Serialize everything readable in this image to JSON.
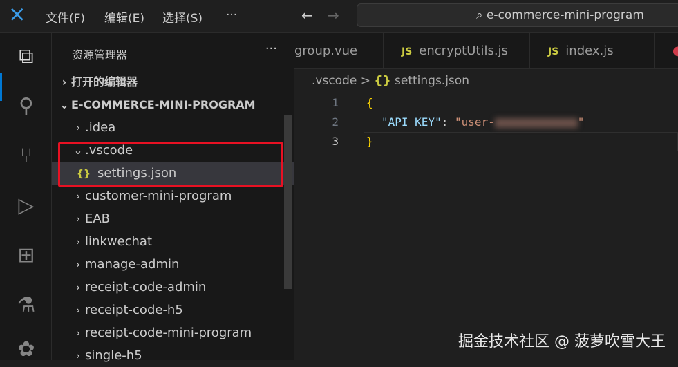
{
  "titlebar": {
    "menus": [
      "文件(F)",
      "编辑(E)",
      "选择(S)",
      "···"
    ],
    "search": "e-commerce-mini-program"
  },
  "sidebar": {
    "title": "资源管理器",
    "more": "···",
    "open_editors": "打开的编辑器",
    "root": "E-COMMERCE-MINI-PROGRAM",
    "items": [
      {
        "label": ".idea",
        "expanded": false,
        "indent": 1
      },
      {
        "label": ".vscode",
        "expanded": true,
        "indent": 1
      },
      {
        "label": "settings.json",
        "file": true,
        "indent": 2
      },
      {
        "label": "customer-mini-program",
        "expanded": false,
        "indent": 1
      },
      {
        "label": "EAB",
        "expanded": false,
        "indent": 1
      },
      {
        "label": "linkwechat",
        "expanded": false,
        "indent": 1
      },
      {
        "label": "manage-admin",
        "expanded": false,
        "indent": 1
      },
      {
        "label": "receipt-code-admin",
        "expanded": false,
        "indent": 1
      },
      {
        "label": "receipt-code-h5",
        "expanded": false,
        "indent": 1
      },
      {
        "label": "receipt-code-mini-program",
        "expanded": false,
        "indent": 1
      },
      {
        "label": "single-h5",
        "expanded": false,
        "indent": 1
      }
    ]
  },
  "tabs": [
    {
      "label": "group.vue"
    },
    {
      "label": "encryptUtils.js",
      "icon": "JS"
    },
    {
      "label": "index.js",
      "icon": "JS"
    }
  ],
  "breadcrumb": {
    "folder": ".vscode",
    "sep": ">",
    "icon": "{}",
    "file": "settings.json"
  },
  "editor": {
    "line_numbers": [
      "1",
      "2",
      "3"
    ],
    "open": "{",
    "key": "\"API KEY\"",
    "colon": ": ",
    "value": "\"user-",
    "value_end": "\"",
    "close": "}"
  },
  "watermark": "掘金技术社区 @ 菠萝吹雪大王"
}
